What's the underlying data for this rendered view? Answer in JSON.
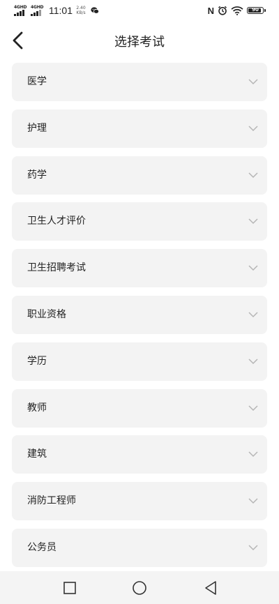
{
  "status_bar": {
    "network_1": "4GHD",
    "network_2": "4GHD",
    "time": "11:01",
    "speed_value": "2.40",
    "speed_unit": "KB/s",
    "nfc": "N",
    "battery_level": "90"
  },
  "header": {
    "title": "选择考试",
    "back_icon": "chevron-left-icon"
  },
  "categories": [
    {
      "label": "医学"
    },
    {
      "label": "护理"
    },
    {
      "label": "药学"
    },
    {
      "label": "卫生人才评价"
    },
    {
      "label": "卫生招聘考试"
    },
    {
      "label": "职业资格"
    },
    {
      "label": "学历"
    },
    {
      "label": "教师"
    },
    {
      "label": "建筑"
    },
    {
      "label": "消防工程师"
    },
    {
      "label": "公务员"
    }
  ],
  "nav_bar": {
    "recent_icon": "square-icon",
    "home_icon": "circle-icon",
    "back_icon": "triangle-back-icon"
  },
  "colors": {
    "item_background": "#f3f3f3",
    "chevron": "#b5b5b5",
    "text": "#222222"
  }
}
